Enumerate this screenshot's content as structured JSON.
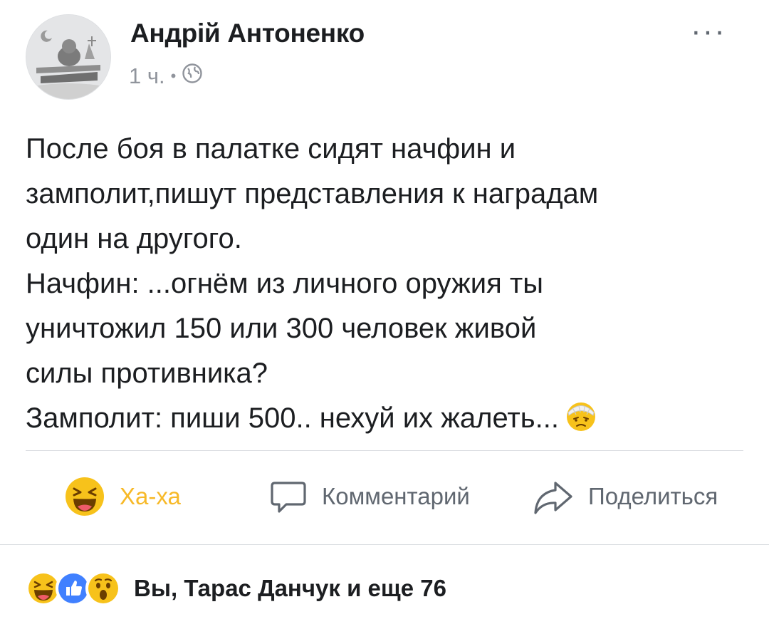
{
  "post": {
    "author": "Андрій Антоненко",
    "time": "1 ч.",
    "separator": "•",
    "audience_icon": "globe-icon",
    "more_label": "···",
    "text_lines": [
      "После боя в палатке сидят начфин и",
      "замполит,пишут представления к наградам",
      "один на другого.",
      "Начфин: ...огнём из личного оружия ты",
      "уничтожил 150 или 300 человек живой",
      "силы противника?",
      "Замполит: пиши 500.. нехуй их жалеть..."
    ],
    "inline_emoji": "bandaged-face-emoji"
  },
  "actions": {
    "haha_label": "Ха-ха",
    "comment_label": "Комментарий",
    "share_label": "Поделиться"
  },
  "reactions": {
    "icons": [
      "haha-icon",
      "like-icon",
      "wow-icon"
    ],
    "summary": "Вы, Тарас Данчук и еще 76"
  },
  "colors": {
    "haha_active": "#f7b928",
    "text": "#1c1e21",
    "secondary": "#90949c",
    "action_gray": "#606770",
    "like_blue": "#4080ff"
  }
}
